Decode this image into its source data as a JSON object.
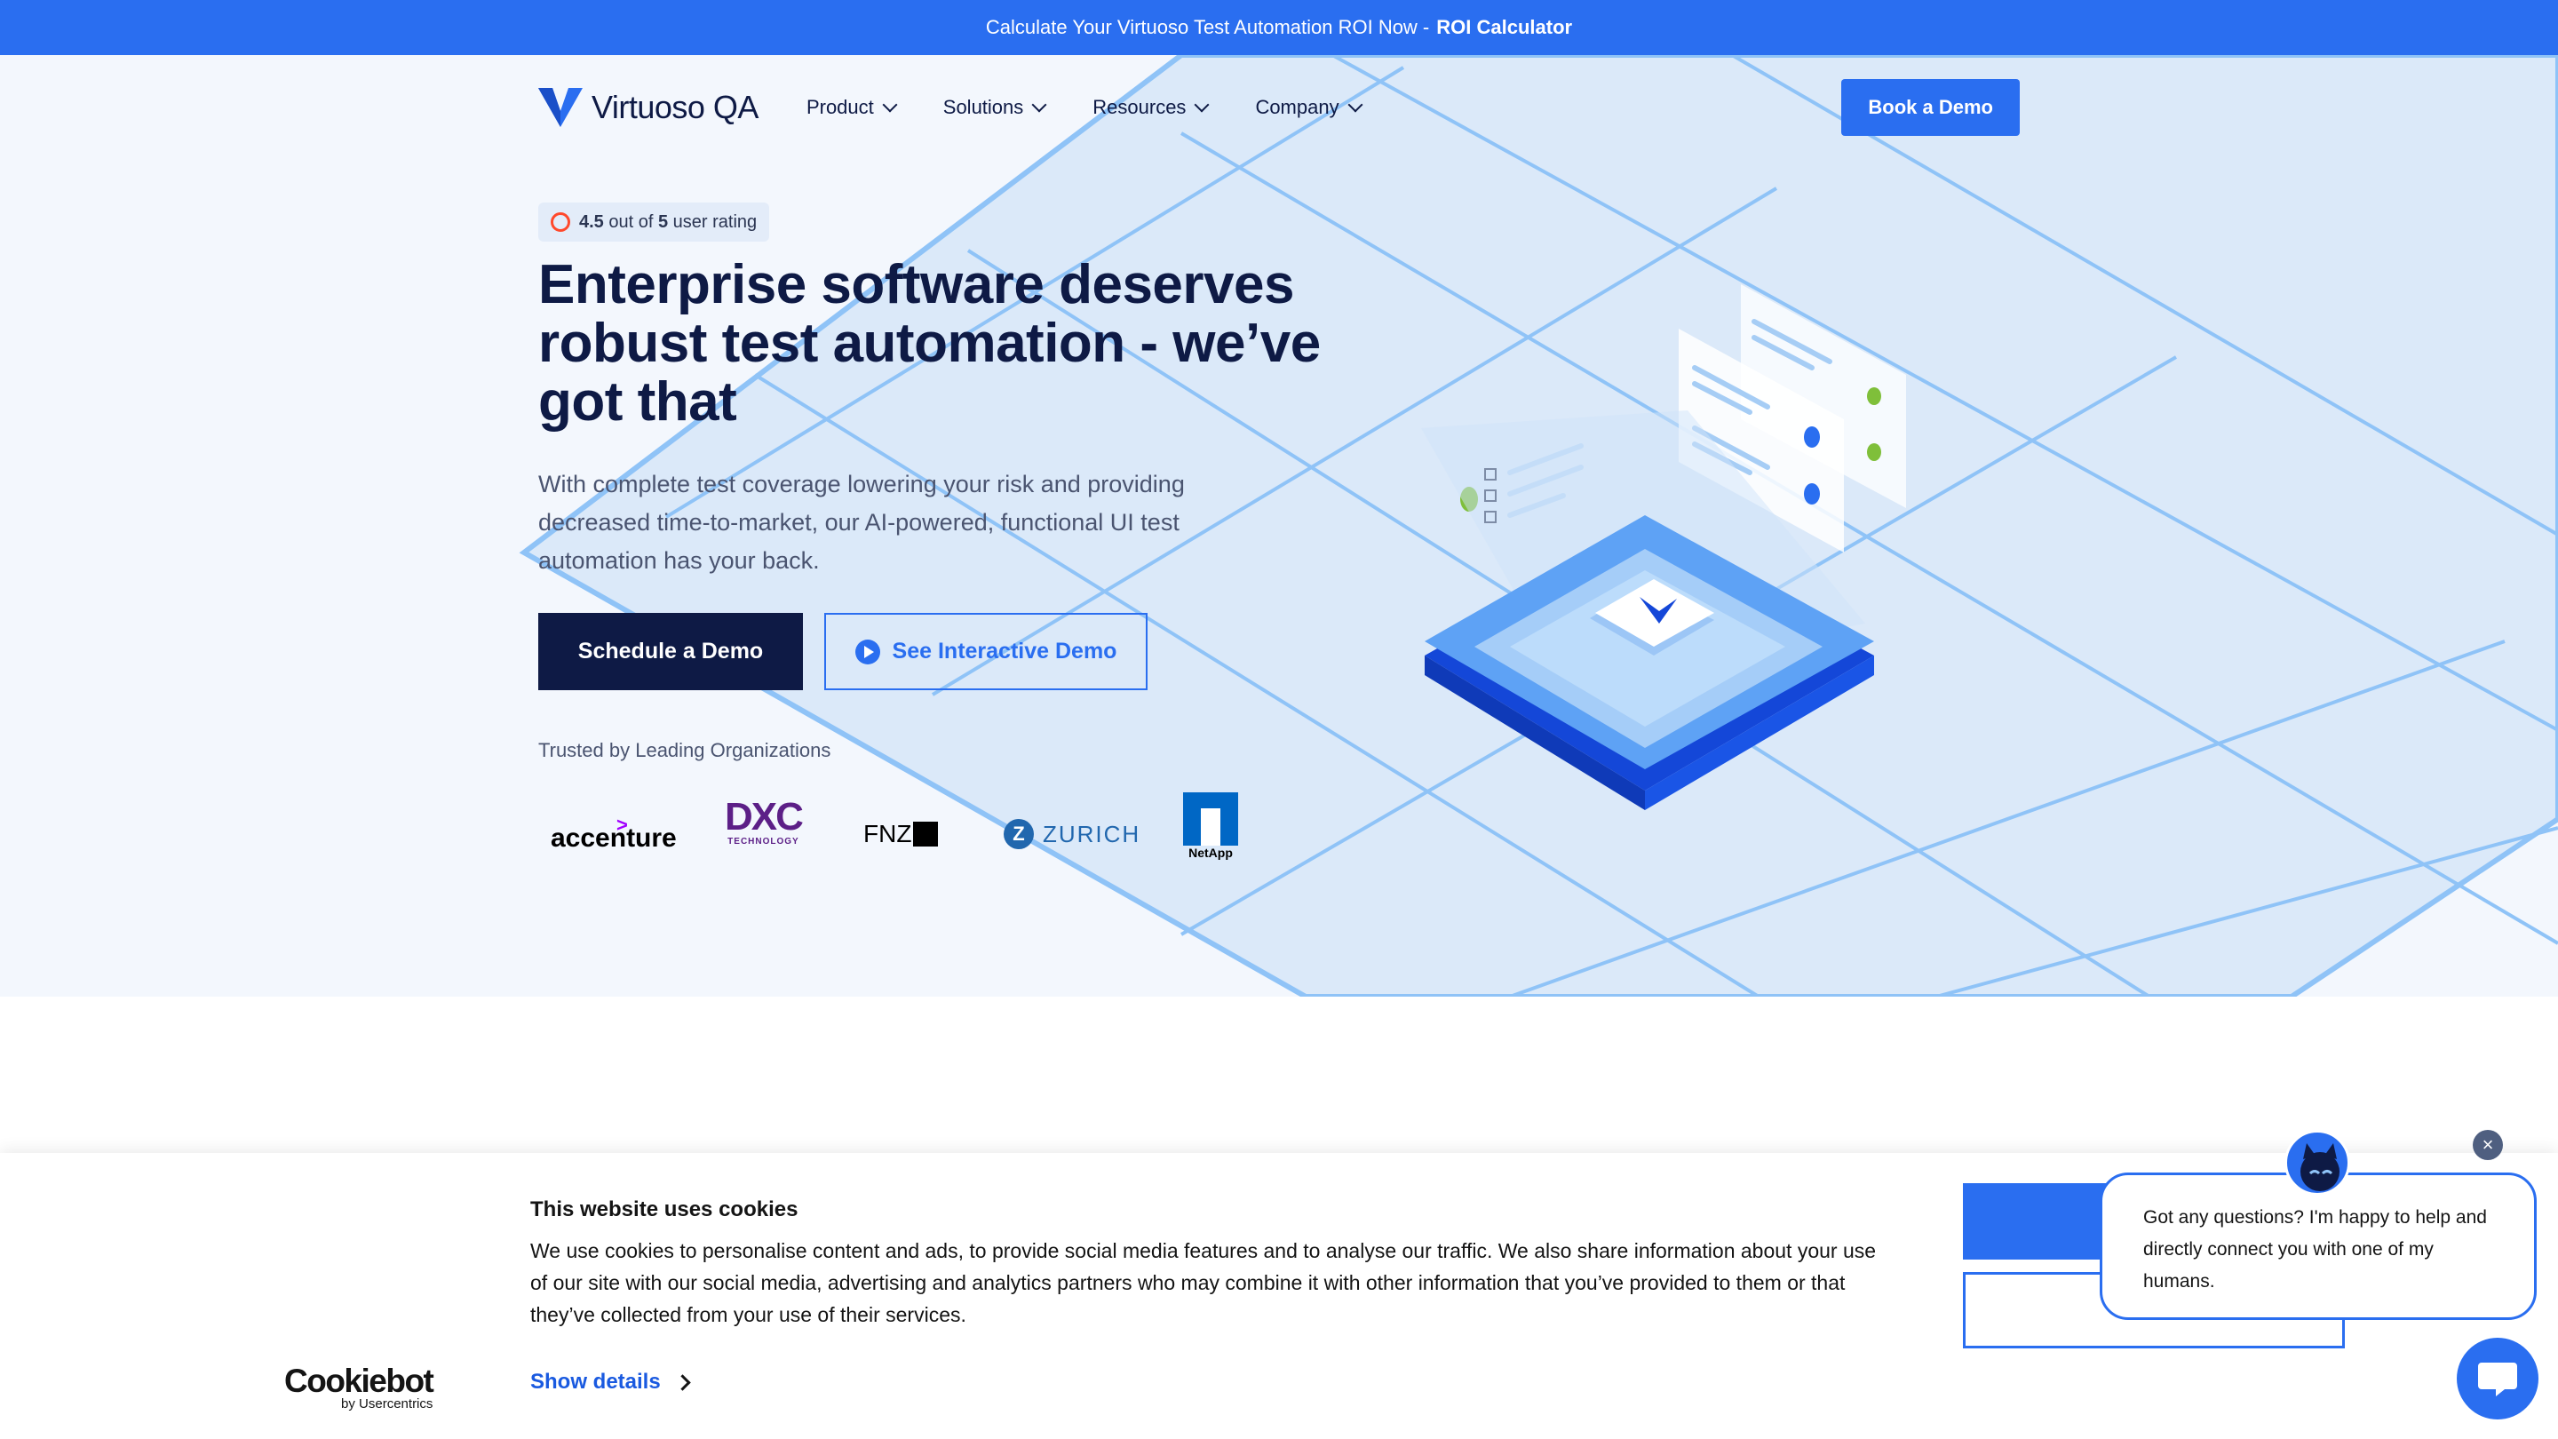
{
  "announcement": {
    "text": "Calculate Your Virtuoso Test Automation ROI Now -",
    "link": "ROI Calculator"
  },
  "nav": {
    "logo_text": "Virtuoso QA",
    "items": [
      {
        "label": "Product"
      },
      {
        "label": "Solutions"
      },
      {
        "label": "Resources"
      },
      {
        "label": "Company"
      }
    ],
    "cta": "Book a Demo"
  },
  "hero": {
    "rating": {
      "score": "4.5",
      "mid": "out of",
      "max": "5",
      "suffix": "user rating"
    },
    "headline": "Enterprise software deserves robust test automation - we’ve got that",
    "subtext": "With complete test coverage lowering your risk and providing decreased time-to-market, our AI-powered, functional UI test automation has your back.",
    "primary_cta": "Schedule a Demo",
    "secondary_cta": "See Interactive Demo",
    "trusted_label": "Trusted by Leading Organizations",
    "logos": [
      {
        "name": "accenture",
        "text": "accenture"
      },
      {
        "name": "dxc",
        "text": "DXC",
        "sub": "TECHNOLOGY"
      },
      {
        "name": "fnz",
        "text": "FNZ"
      },
      {
        "name": "zurich",
        "text": "ZURICH"
      },
      {
        "name": "netapp",
        "text": "NetApp"
      }
    ]
  },
  "cookie": {
    "title": "This website uses cookies",
    "body": "We use cookies to personalise content and ads, to provide social media features and to analyse our traffic. We also share information about your use of our site with our social media, advertising and analytics partners who may combine it with other information that you’ve provided to them or that they’ve collected from your use of their services.",
    "show_details": "Show details",
    "brand": "Cookiebot",
    "brand_by": "by Usercentrics"
  },
  "chat": {
    "message": "Got any questions? I'm happy to help and directly connect you with one of my humans."
  },
  "colors": {
    "primary": "#2a6ef0",
    "navy": "#0e1a45",
    "hero_bg": "#f3f7fd"
  }
}
